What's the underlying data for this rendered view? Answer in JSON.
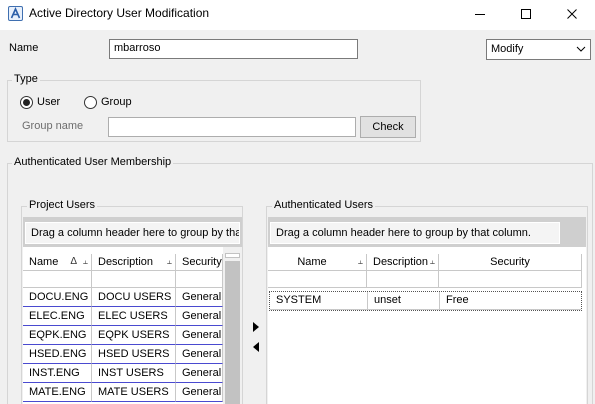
{
  "window": {
    "title": "Active Directory User Modification",
    "icon": "a-letter-icon",
    "controls": [
      "minimize-icon",
      "maximize-icon",
      "close-icon"
    ]
  },
  "name": {
    "label": "Name",
    "value": "mbarroso"
  },
  "action_select": {
    "value": "Modify"
  },
  "type": {
    "title": "Type",
    "options": [
      {
        "label": "User",
        "checked": true
      },
      {
        "label": "Group",
        "checked": false
      }
    ],
    "group_name_label": "Group name",
    "group_name_value": "",
    "check_button": "Check"
  },
  "membership": {
    "title": "Authenticated User Membership"
  },
  "project_users": {
    "title": "Project Users",
    "group_hint": "Drag a column header here to group by that column.",
    "columns": [
      "Name",
      "Description",
      "Security"
    ],
    "sort_glyph": "Δ",
    "rows": [
      [
        "DOCU.ENG",
        "DOCU USERS",
        "General"
      ],
      [
        "ELEC.ENG",
        "ELEC USERS",
        "General"
      ],
      [
        "EQPK.ENG",
        "EQPK USERS",
        "General"
      ],
      [
        "HSED.ENG",
        "HSED USERS",
        "General"
      ],
      [
        "INST.ENG",
        "INST USERS",
        "General"
      ],
      [
        "MATE.ENG",
        "MATE USERS",
        "General"
      ]
    ]
  },
  "authenticated_users": {
    "title": "Authenticated Users",
    "group_hint": "Drag a column header here to group by that column.",
    "columns": [
      "Name",
      "Description",
      "Security"
    ],
    "rows": [
      [
        "SYSTEM",
        "unset",
        "Free"
      ]
    ]
  },
  "colors": {
    "link_row_border": "#4a4ad0",
    "group_panel": "#cfcfcf"
  }
}
